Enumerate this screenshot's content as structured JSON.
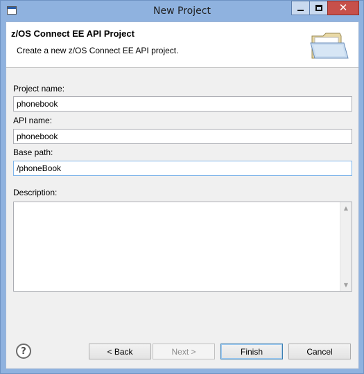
{
  "window": {
    "title": "New Project",
    "close_label": "✕"
  },
  "banner": {
    "title": "z/OS Connect EE API Project",
    "description": "Create a new z/OS Connect EE API project.",
    "icon": "open-folder-icon"
  },
  "form": {
    "project_name_label": "Project name:",
    "project_name_value": "phonebook",
    "api_name_label": "API name:",
    "api_name_value": "phonebook",
    "base_path_label": "Base path:",
    "base_path_value": "/phoneBook",
    "description_label": "Description:",
    "description_value": ""
  },
  "buttons": {
    "help": "?",
    "back": "< Back",
    "next": "Next >",
    "finish": "Finish",
    "cancel": "Cancel"
  },
  "colors": {
    "titlebar": "#8fb2df",
    "close_button": "#c7504a",
    "dialog_bg": "#f0f0f0",
    "focus_border": "#7eb4ea"
  }
}
